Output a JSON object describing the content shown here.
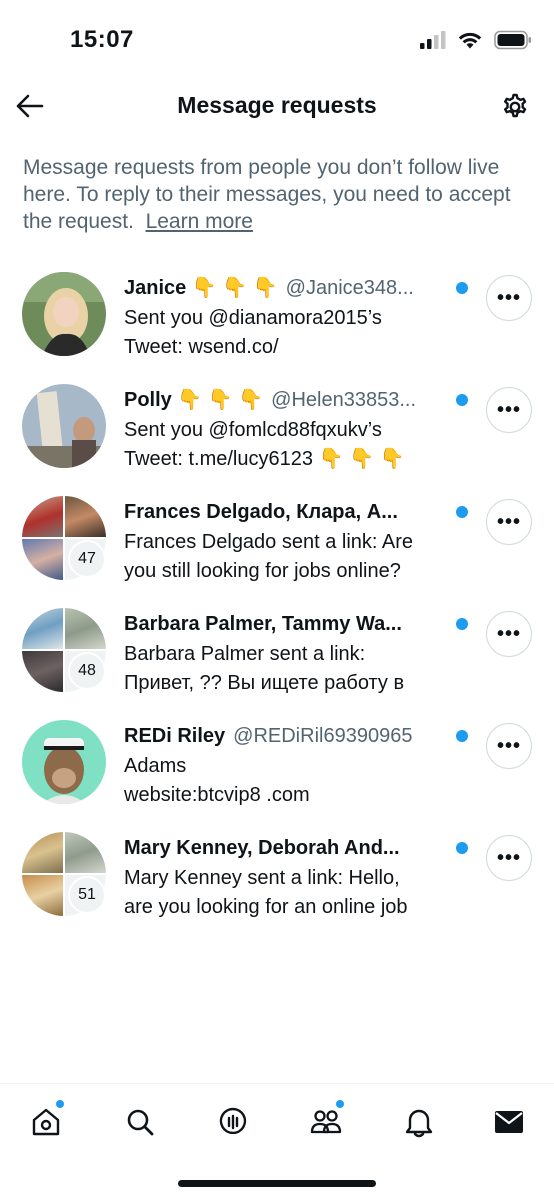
{
  "status_bar": {
    "time": "15:07"
  },
  "header": {
    "title": "Message requests"
  },
  "intro": {
    "text": "Message requests from people you don’t follow live here. To reply to their messages, you need to accept the request.",
    "link": "Learn more"
  },
  "requests": [
    {
      "name": "Janice 👇 👇 👇",
      "handle": "@Janice348...",
      "preview": "Sent you @dianamora2015’s\nTweet:   wsend.co/",
      "unread": true,
      "count": ""
    },
    {
      "name": "Polly 👇 👇 👇",
      "handle": "@Helen33853...",
      "preview": "Sent you @fomlcd88fqxukv’s\nTweet:  t.me/lucy6123 👇 👇 👇",
      "unread": true,
      "count": ""
    },
    {
      "name": "Frances Delgado, Клара, A...",
      "handle": "",
      "preview": "Frances Delgado sent a link: Are\nyou still looking for jobs online?",
      "unread": true,
      "count": "47"
    },
    {
      "name": "Barbara Palmer, Tammy Wa...",
      "handle": "",
      "preview": "Barbara Palmer sent a link:\nПривет, ?? Вы ищете работу в",
      "unread": true,
      "count": "48"
    },
    {
      "name": "REDi Riley",
      "handle": "@REDiRil69390965",
      "preview": "Adams\nwebsite:btcvip8 .com",
      "unread": true,
      "count": ""
    },
    {
      "name": "Mary Kenney, Deborah And...",
      "handle": "",
      "preview": "Mary Kenney sent a link: Hello,\nare you looking for an online job",
      "unread": true,
      "count": "51"
    }
  ],
  "more_label": "•••",
  "colors": {
    "accent": "#1d9bf0",
    "secondary_text": "#536471",
    "border": "#cfd9de"
  }
}
